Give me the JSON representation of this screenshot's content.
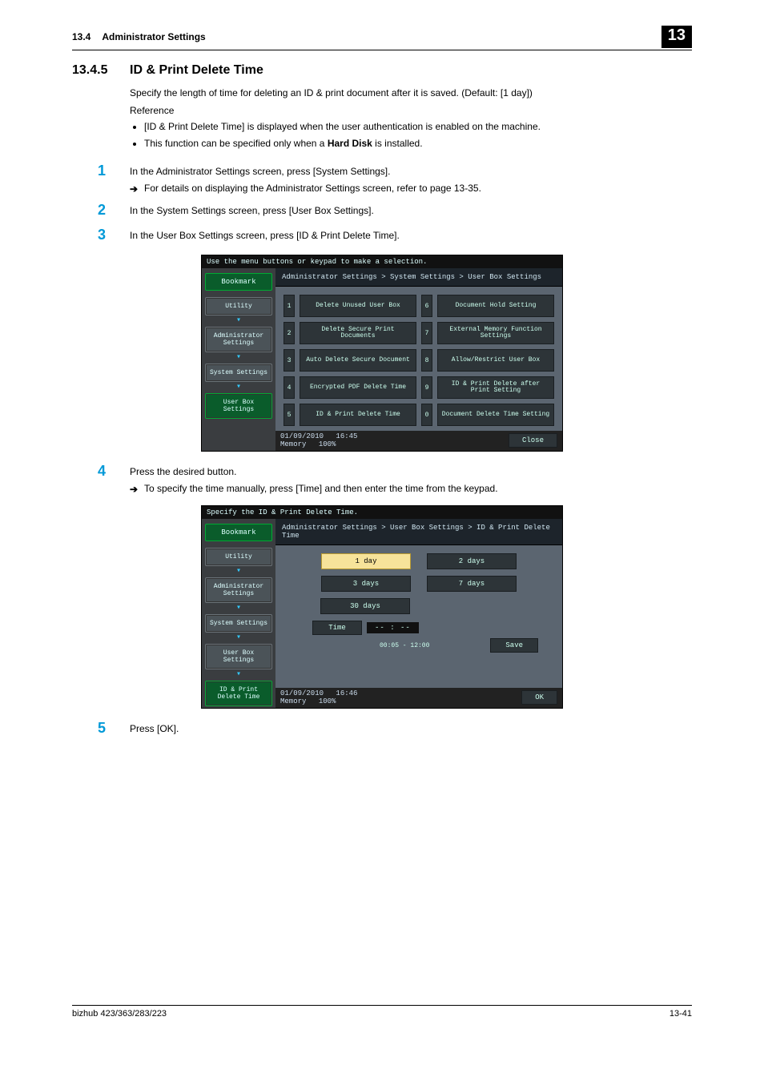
{
  "header": {
    "sec_num": "13.4",
    "sec_title": "Administrator Settings",
    "chapter": "13"
  },
  "heading": {
    "num": "13.4.5",
    "text": "ID & Print Delete Time"
  },
  "intro": "Specify the length of time for deleting an ID & print document after it is saved. (Default: [1 day])",
  "reference_label": "Reference",
  "bullets": [
    "[ID & Print Delete Time] is displayed when the user authentication is enabled on the machine.",
    "This function can be specified only when a <b>Hard Disk</b> is installed."
  ],
  "steps": {
    "1": {
      "text": "In the Administrator Settings screen, press [System Settings].",
      "sub": "For details on displaying the Administrator Settings screen, refer to page 13-35."
    },
    "2": {
      "text": "In the System Settings screen, press [User Box Settings]."
    },
    "3": {
      "text": "In the User Box Settings screen, press [ID & Print Delete Time]."
    },
    "4": {
      "text": "Press the desired button.",
      "sub": "To specify the time manually, press [Time] and then enter the time from the keypad."
    },
    "5": {
      "text": "Press [OK]."
    }
  },
  "screen1": {
    "top": "Use the menu buttons or keypad to make a selection.",
    "bookmark": "Bookmark",
    "side": [
      "Utility",
      "Administrator Settings",
      "System Settings",
      "User Box Settings"
    ],
    "crumb": "Administrator Settings > System Settings > User Box Settings",
    "items": [
      {
        "n": "1",
        "l": "Delete Unused User Box"
      },
      {
        "n": "6",
        "l": "Document Hold Setting"
      },
      {
        "n": "2",
        "l": "Delete Secure Print Documents"
      },
      {
        "n": "7",
        "l": "External Memory Function Settings"
      },
      {
        "n": "3",
        "l": "Auto Delete Secure Document"
      },
      {
        "n": "8",
        "l": "Allow/Restrict User Box"
      },
      {
        "n": "4",
        "l": "Encrypted PDF Delete Time"
      },
      {
        "n": "9",
        "l": "ID & Print Delete after Print Setting"
      },
      {
        "n": "5",
        "l": "ID & Print Delete Time"
      },
      {
        "n": "0",
        "l": "Document Delete Time Setting"
      }
    ],
    "footer": {
      "date": "01/09/2010",
      "time": "16:45",
      "mem_label": "Memory",
      "mem": "100%",
      "close": "Close"
    }
  },
  "screen2": {
    "top": "Specify the ID & Print Delete Time.",
    "bookmark": "Bookmark",
    "side": [
      "Utility",
      "Administrator Settings",
      "System Settings",
      "User Box Settings",
      "ID & Print Delete Time"
    ],
    "crumb": "Administrator Settings > User Box Settings > ID & Print Delete Time",
    "options": {
      "r1a": "1 day",
      "r1b": "2 days",
      "r2a": "3 days",
      "r2b": "7 days",
      "r3a": "30 days",
      "time_label": "Time",
      "time_value": "-- : --",
      "time_range": "00:05  -  12:00",
      "save": "Save"
    },
    "footer": {
      "date": "01/09/2010",
      "time": "16:46",
      "mem_label": "Memory",
      "mem": "100%",
      "ok": "OK"
    }
  },
  "footer": {
    "left": "bizhub 423/363/283/223",
    "right": "13-41"
  }
}
